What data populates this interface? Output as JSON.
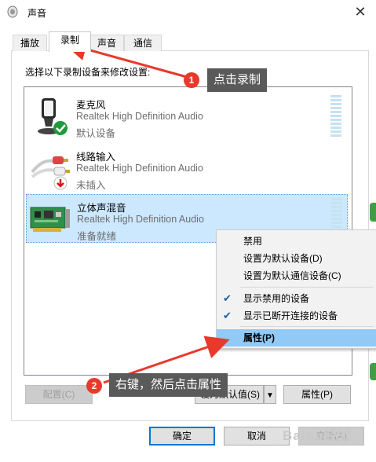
{
  "window": {
    "title": "声音",
    "close_glyph": "✕"
  },
  "tabs": [
    {
      "label": "播放",
      "active": false
    },
    {
      "label": "录制",
      "active": true
    },
    {
      "label": "声音",
      "active": false
    },
    {
      "label": "通信",
      "active": false
    }
  ],
  "instruction": "选择以下录制设备来修改设置:",
  "devices": [
    {
      "name": "麦克风",
      "driver": "Realtek High Definition Audio",
      "status": "默认设备",
      "icon": "microphone-icon",
      "badge": "green-check"
    },
    {
      "name": "线路输入",
      "driver": "Realtek High Definition Audio",
      "status": "未插入",
      "icon": "line-in-cable-icon",
      "badge": "red-down-arrow"
    },
    {
      "name": "立体声混音",
      "driver": "Realtek High Definition Audio",
      "status": "准备就绪",
      "icon": "sound-card-icon",
      "badge": "",
      "selected": true
    }
  ],
  "buttons": {
    "configure": "配置(C)",
    "set_default": "设为默认值(S)",
    "properties": "属性(P)",
    "ok": "确定",
    "cancel": "取消",
    "apply": "应用(A)"
  },
  "context_menu": {
    "items": [
      {
        "label": "禁用",
        "checked": false
      },
      {
        "label": "设置为默认设备(D)",
        "checked": false
      },
      {
        "label": "设置为默认通信设备(C)",
        "checked": false
      },
      {
        "label": "显示禁用的设备",
        "checked": true
      },
      {
        "label": "显示已断开连接的设备",
        "checked": true
      },
      {
        "label": "属性(P)",
        "checked": false,
        "highlighted": true
      }
    ]
  },
  "annotations": [
    {
      "number": "1",
      "text": "点击录制"
    },
    {
      "number": "2",
      "text": "右键，然后点击属性"
    }
  ],
  "watermark": "Baidu经验",
  "colors": {
    "accent": "#0078d7",
    "annotation_red": "#e8392b",
    "callout_bg": "#5a5a5a",
    "selection": "#cce8ff",
    "menu_highlight": "#91c9f7"
  }
}
